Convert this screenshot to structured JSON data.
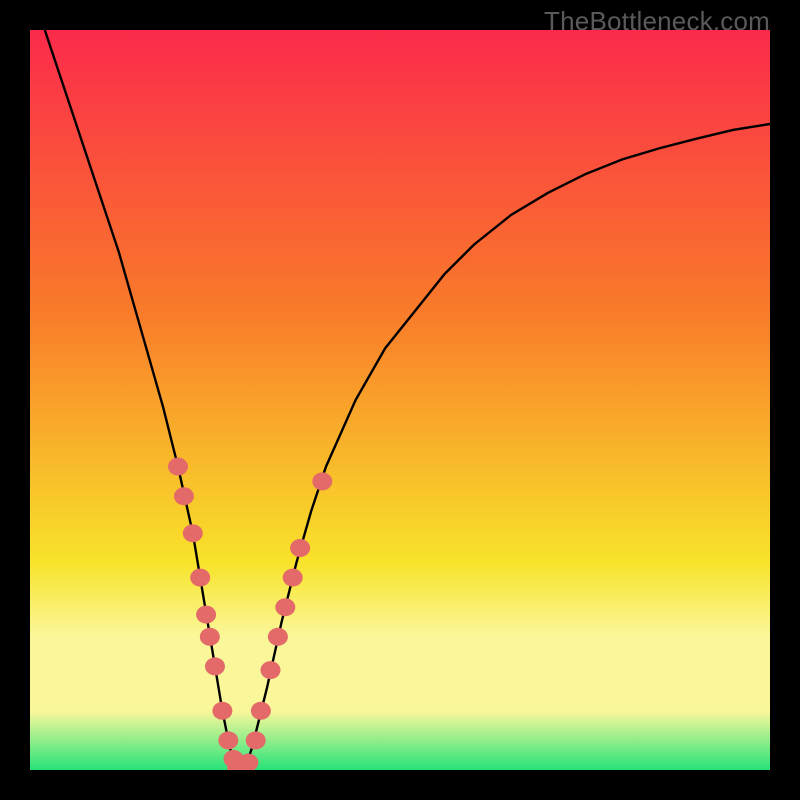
{
  "watermark": "TheBottleneck.com",
  "colors": {
    "frame": "#000000",
    "grad_top": "#fb2a4b",
    "grad_mid1": "#f97b2a",
    "grad_mid2": "#f8e32a",
    "grad_band": "#faf79a",
    "grad_bottom": "#27e37a",
    "curve": "#000000",
    "marker_fill": "#e46a6a",
    "marker_stroke": "#cc5050"
  },
  "chart_data": {
    "type": "line",
    "title": "",
    "xlabel": "",
    "ylabel": "",
    "xlim": [
      0,
      100
    ],
    "ylim": [
      0,
      100
    ],
    "curve": {
      "x": [
        2,
        4,
        6,
        8,
        10,
        12,
        14,
        16,
        18,
        20,
        22,
        24,
        25,
        26,
        27,
        28,
        29,
        30,
        32,
        34,
        36,
        38,
        40,
        44,
        48,
        52,
        56,
        60,
        65,
        70,
        75,
        80,
        85,
        90,
        95,
        100
      ],
      "y": [
        100,
        94,
        88,
        82,
        76,
        70,
        63,
        56,
        49,
        41,
        32,
        20,
        14,
        8,
        3,
        0,
        0,
        3,
        11,
        20,
        28,
        35,
        41,
        50,
        57,
        62,
        67,
        71,
        75,
        78,
        80.5,
        82.5,
        84,
        85.3,
        86.5,
        87.3
      ]
    },
    "markers": [
      {
        "x": 20.0,
        "y": 41.0
      },
      {
        "x": 20.8,
        "y": 37.0
      },
      {
        "x": 22.0,
        "y": 32.0
      },
      {
        "x": 23.0,
        "y": 26.0
      },
      {
        "x": 23.8,
        "y": 21.0
      },
      {
        "x": 24.3,
        "y": 18.0
      },
      {
        "x": 25.0,
        "y": 14.0
      },
      {
        "x": 26.0,
        "y": 8.0
      },
      {
        "x": 26.8,
        "y": 4.0
      },
      {
        "x": 27.5,
        "y": 1.5
      },
      {
        "x": 28.0,
        "y": 0.3
      },
      {
        "x": 28.8,
        "y": 0.3
      },
      {
        "x": 29.5,
        "y": 1.0
      },
      {
        "x": 30.5,
        "y": 4.0
      },
      {
        "x": 31.2,
        "y": 8.0
      },
      {
        "x": 32.5,
        "y": 13.5
      },
      {
        "x": 33.5,
        "y": 18.0
      },
      {
        "x": 34.5,
        "y": 22.0
      },
      {
        "x": 35.5,
        "y": 26.0
      },
      {
        "x": 36.5,
        "y": 30.0
      },
      {
        "x": 39.5,
        "y": 39.0
      }
    ]
  }
}
